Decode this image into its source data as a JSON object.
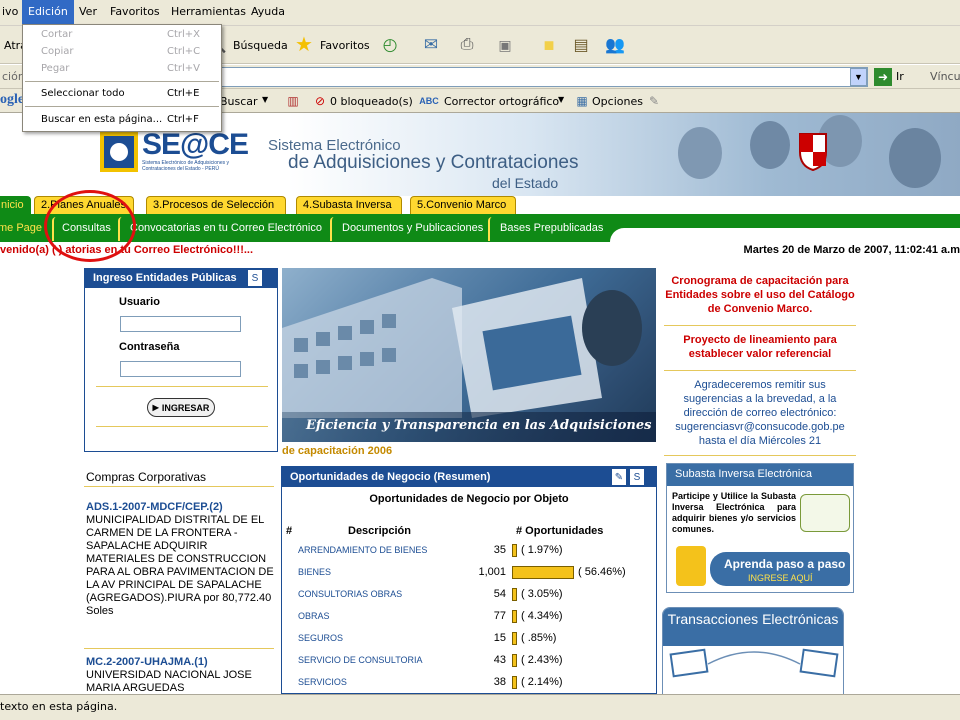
{
  "menubar": {
    "items": [
      "ivo",
      "Edición",
      "Ver",
      "Favoritos",
      "Herramientas",
      "Ayuda"
    ]
  },
  "toolbar": {
    "back_label": "Atrá",
    "search_label": "Búsqueda",
    "favorites_label": "Favoritos"
  },
  "addressbar": {
    "label": "ción",
    "go_label": "Ir",
    "links_label": "Víncul"
  },
  "googlebar": {
    "logo": "ogle",
    "search_label": "Buscar",
    "blocked_label": "0 bloqueado(s)",
    "spell_label": "Corrector ortográfico",
    "options_label": "Opciones"
  },
  "edit_menu": {
    "items": [
      {
        "label": "Cortar",
        "shortcut": "Ctrl+X",
        "disabled": true
      },
      {
        "label": "Copiar",
        "shortcut": "Ctrl+C",
        "disabled": true
      },
      {
        "label": "Pegar",
        "shortcut": "Ctrl+V",
        "disabled": true
      },
      {
        "label": "Seleccionar todo",
        "shortcut": "Ctrl+E",
        "disabled": false
      },
      {
        "label": "Buscar en esta página...",
        "shortcut": "Ctrl+F",
        "disabled": false
      }
    ]
  },
  "banner": {
    "logo": "SE@CE",
    "logo_subtitle": "Sistema Electrónico de Adquisiciones y Contrataciones del Estado - PERÚ",
    "title_line1": "Sistema Electrónico",
    "title_line2": "de Adquisiciones y Contrataciones",
    "title_line3": "del Estado"
  },
  "tabs": [
    "nicio",
    "2.Planes Anuales",
    "3.Procesos de Selección",
    "4.Subasta Inversa",
    "5.Convenio Marco"
  ],
  "nav": [
    "me Page",
    "Consultas",
    "Convocatorias en tu Correo Electrónico",
    "Documentos y Publicaciones",
    "Bases Prepublicadas"
  ],
  "welcome": "venido(a) ( ) atorias en tu Correo Electrónico!!!...",
  "datetime": "Martes 20 de Marzo de 2007, 11:02:41 a.m",
  "login": {
    "title": "Ingreso Entidades Públicas",
    "user_label": "Usuario",
    "password_label": "Contraseña",
    "button": "INGRESAR"
  },
  "photo": {
    "caption": "Eficiencia y Transparencia en las Adquisiciones"
  },
  "capacitacion_strip": "de capacitación 2006",
  "right": {
    "link1": "Cronograma de capacitación para Entidades sobre el uso del Catálogo de Convenio Marco.",
    "link2": "Proyecto de lineamiento para establecer valor referencial",
    "notice": "Agradeceremos remitir sus sugerencias a la brevedad, a la dirección de correo electrónico: sugerenciasvr@consucode.gob.pe hasta el día Miércoles 21",
    "subasta_title": "Subasta Inversa Electrónica",
    "subasta_text": "Participe y Utilice la Subasta Inversa Electrónica para adquirir bienes y/o servicios comunes.",
    "subasta_link": "Aprenda paso a paso",
    "subasta_link2": "INGRESE AQUÍ",
    "transac_title": "Transacciones Electrónicas"
  },
  "compras": {
    "title": "Compras Corporativas",
    "item1_code": "ADS.1-2007-MDCF/CEP.(2)",
    "item1_text": "MUNICIPALIDAD DISTRITAL DE EL CARMEN DE LA FRONTERA - SAPALACHE ADQUIRIR MATERIALES DE CONSTRUCCION PARA AL OBRA PAVIMENTACION DE LA AV PRINCIPAL DE SAPALACHE (AGREGADOS).PIURA por 80,772.40 Soles",
    "item2_code": "MC.2-2007-UHAJMA.(1)",
    "item2_text": "UNIVERSIDAD NACIONAL JOSE MARIA ARGUEDAS"
  },
  "oportunidades": {
    "title": "Oportunidades de Negocio (Resumen)",
    "subtitle": "Oportunidades de Negocio por Objeto",
    "col_hash": "#",
    "col_desc": "Descripción",
    "col_count": "# Oportunidades",
    "rows": [
      {
        "desc": "ARRENDAMIENTO DE BIENES",
        "count": "35",
        "pct": "( 1.97%)",
        "share": 0.0197
      },
      {
        "desc": "BIENES",
        "count": "1,001",
        "pct": "( 56.46%)",
        "share": 0.5646
      },
      {
        "desc": "CONSULTORIAS OBRAS",
        "count": "54",
        "pct": "( 3.05%)",
        "share": 0.0305
      },
      {
        "desc": "OBRAS",
        "count": "77",
        "pct": "( 4.34%)",
        "share": 0.0434
      },
      {
        "desc": "SEGUROS",
        "count": "15",
        "pct": "( .85%)",
        "share": 0.0085
      },
      {
        "desc": "SERVICIO DE CONSULTORIA",
        "count": "43",
        "pct": "( 2.43%)",
        "share": 0.0243
      },
      {
        "desc": "SERVICIOS",
        "count": "38",
        "pct": "( 2.14%)",
        "share": 0.0214
      }
    ]
  },
  "status": "texto en esta página."
}
